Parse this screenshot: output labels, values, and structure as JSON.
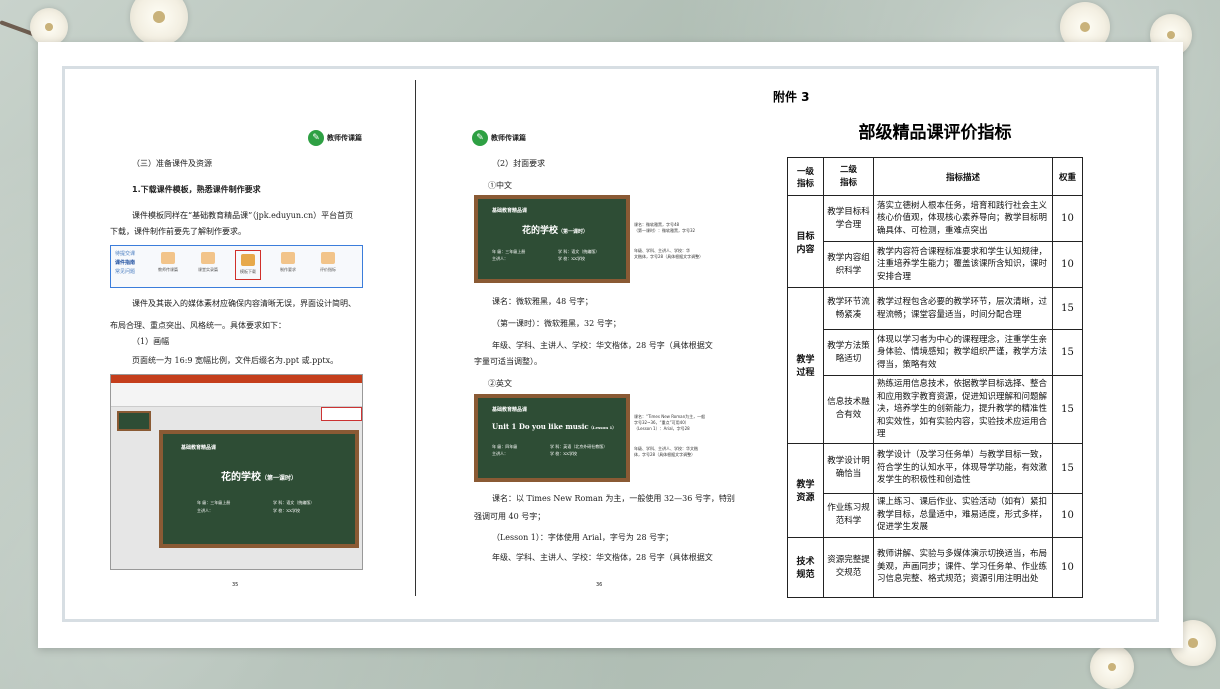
{
  "left_page": {
    "logo_text": "教师传课篇",
    "heading_section": "（三）准备课件及资源",
    "heading_sub": "1.下载课件模板，熟悉课件制作要求",
    "para1_line1": "课件模板同样在“基础教育精品课”（jpk.eduyun.cn）平台首页",
    "para1_line2": "下载，课件制作前要先了解制作要求。",
    "toolbar": {
      "side_items": [
        "待提交课",
        "课件指南",
        "常见问题"
      ],
      "icons": [
        "教师传课篇",
        "课堂实录篇",
        "模板下载",
        "制作要求",
        "评价指标"
      ]
    },
    "para2_line1": "课件及其嵌入的媒体素材应确保内容清晰无误，界面设计简明、",
    "para2_line2": "布局合理、重点突出、风格统一。具体要求如下：",
    "sub1": "（1）画幅",
    "para3": "页面统一为 16:9 宽幅比例，文件后缀名为.ppt 或.pptx。",
    "ppt": {
      "board_brand": "基础教育精品课",
      "board_title": "花的学校",
      "board_title_suffix": "（第一课时）",
      "board_info_l1": "年  级：三年级上册",
      "board_info_l2": "主讲人：",
      "board_info_r1": "学  科：语文（统编版）",
      "board_info_r2": "学  校：XX学校"
    },
    "page_number": "35"
  },
  "right_page": {
    "logo_text": "教师传课篇",
    "sub2": "（2）封面要求",
    "cn_label": "①中文",
    "cover_cn": {
      "brand": "基础教育精品课",
      "title": "花的学校",
      "title_suffix": "（第一课时）",
      "info_l1": "年  级：三年级上册",
      "info_l2": "主讲人：",
      "info_r1": "学  科：语文（统编版）",
      "info_r2": "学  校：XX学校",
      "note1_l1": "课名：微软雅黑，字号48",
      "note1_l2": "（第一课时）：微软雅黑，字号32",
      "note2_l1": "年级、学科、主讲人、学校：华",
      "note2_l2": "文楷体，字号28（具体根据文字调整）"
    },
    "cn_spec1": "课名：微软雅黑，48 号字；",
    "cn_spec2": "（第一课时）：微软雅黑，32 号字；",
    "cn_spec3_l1": "年级、学科、主讲人、学校：华文楷体，28 号字（具体根据文",
    "cn_spec3_l2": "字量可适当调整）。",
    "en_label": "②英文",
    "cover_en": {
      "brand": "基础教育精品课",
      "title": "Unit 1  Do you like music",
      "title_suffix": "（Lesson 1）",
      "info_l1": "年  级：四年级",
      "info_l2": "主讲人：",
      "info_r1": "学  科：英语（北京外研社教版）",
      "info_r2": "学  校：XX学校",
      "note1_l1": "课名：“Times New Roman为主，一般",
      "note1_l2": "字号32~36，“重点”可用40）",
      "note1_l3": "（Lesson 1）：Arial，字号28",
      "note2_l1": "年级、学科、主讲人、学校：华文楷",
      "note2_l2": "体，字号28（具体根据文字调整）"
    },
    "en_spec1_l1": "课名：以 Times New Roman 为主，一般使用 32—36 号字，特别",
    "en_spec1_l2": "强调可用 40 号字；",
    "en_spec2": "（Lesson 1）：字体使用 Arial，字号为 28 号字；",
    "en_spec3": "年级、学科、主讲人、学校：华文楷体，28 号字（具体根据文",
    "page_number": "36"
  },
  "appendix_label": "附件 3",
  "doc_title": "部级精品课评价指标",
  "table": {
    "headers": [
      "一级\n指标",
      "二级\n指标",
      "指标描述",
      "权重"
    ],
    "h1": "一级指标",
    "h2": "二级指标",
    "h3": "指标描述",
    "h4": "权重",
    "groups": [
      {
        "level1": "目标\n内容",
        "rows": [
          {
            "level2": "教学目标科学合理",
            "desc": "落实立德树人根本任务，培育和践行社会主义核心价值观，体现核心素养导向；教学目标明确具体、可检测，重难点突出",
            "weight": "10"
          },
          {
            "level2": "教学内容组织科学",
            "desc": "教学内容符合课程标准要求和学生认知规律，注重培养学生能力；覆盖该课所含知识，课时安排合理",
            "weight": "10"
          }
        ]
      },
      {
        "level1": "教学\n过程",
        "rows": [
          {
            "level2": "教学环节流畅紧凑",
            "desc": "教学过程包含必要的教学环节，层次清晰，过程流畅；课堂容量适当，时间分配合理",
            "weight": "15"
          },
          {
            "level2": "教学方法策略适切",
            "desc": "体现以学习者为中心的课程理念，注重学生亲身体验、情境感知；教学组织严谨，教学方法得当，策略有效",
            "weight": "15"
          },
          {
            "level2": "信息技术融合有效",
            "desc": "熟练运用信息技术，依据教学目标选择、整合和应用数字教育资源，促进知识理解和问题解决，培养学生的创新能力，提升教学的精准性和实效性，如有实验内容，实验技术应运用合理",
            "weight": "15"
          }
        ]
      },
      {
        "level1": "教学\n资源",
        "rows": [
          {
            "level2": "教学设计明确恰当",
            "desc": "教学设计（及学习任务单）与教学目标一致，符合学生的认知水平，体现导学功能，有效激发学生的积极性和创造性",
            "weight": "15"
          },
          {
            "level2": "作业练习规范科学",
            "desc": "课上练习、课后作业、实验活动（如有）紧扣教学目标，总量适中，难易适度，形式多样，促进学生发展",
            "weight": "10"
          }
        ]
      },
      {
        "level1": "技术\n规范",
        "rows": [
          {
            "level2": "资源完整提交规范",
            "desc": "教师讲解、实验与多媒体演示切换适当，布局美观，声画同步；课件、学习任务单、作业练习信息完整、格式规范；资源引用注明出处",
            "weight": "10"
          }
        ]
      }
    ]
  }
}
